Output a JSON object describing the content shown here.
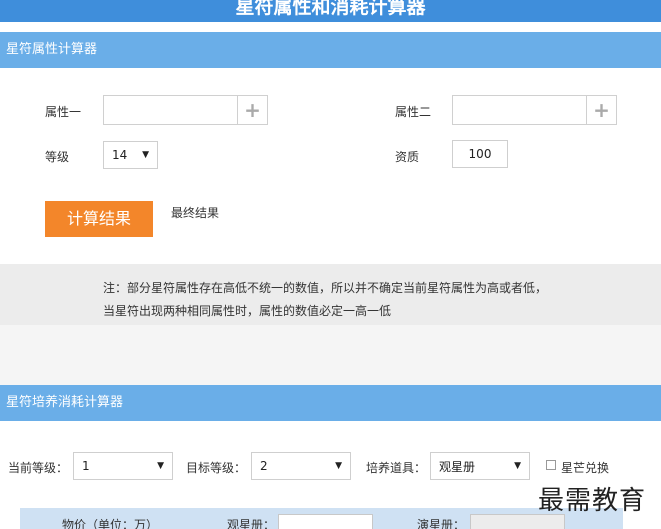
{
  "page_title": "星符属性和消耗计算器",
  "attribute_calc": {
    "section_title": "星符属性计算器",
    "attr1_label": "属性一",
    "attr2_label": "属性二",
    "level_label": "等级",
    "level_value": "14",
    "quality_label": "资质",
    "quality_value": "100",
    "calc_button": "计算结果",
    "result_label": "最终结果",
    "notice_line1": "注：部分星符属性存在高低不统一的数值，所以并不确定当前星符属性为高或者低，",
    "notice_line2": "当星符出现两种相同属性时，属性的数值必定一高一低"
  },
  "cost_calc": {
    "section_title": "星符培养消耗计算器",
    "current_level_label": "当前等级：",
    "current_level_value": "1",
    "target_level_label": "目标等级：",
    "target_level_value": "2",
    "item_label": "培养道具：",
    "item_value": "观星册",
    "exchange_label": "星芒兑换",
    "price_label": "物价（单位：万）",
    "guanxing_label": "观星册：",
    "yanxing_label": "演星册："
  },
  "watermark": "最需教育"
}
